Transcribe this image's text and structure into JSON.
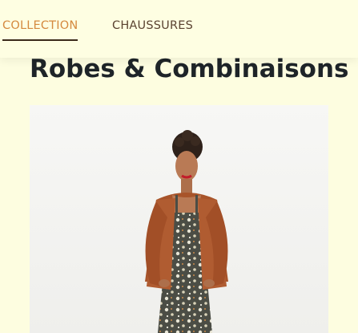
{
  "nav": {
    "tabs": [
      {
        "label": "COLLECTION",
        "active": true
      },
      {
        "label": "CHAUSSURES",
        "active": false
      }
    ],
    "active_color": "#d58a3f",
    "inactive_color": "#5b4331"
  },
  "page": {
    "title": "Robes & Combinaisons"
  },
  "product": {
    "image": "model-in-floral-jumpsuit-and-rust-cardigan"
  },
  "colors": {
    "background": "#fdfde0",
    "title": "#1e2428",
    "cardigan": "#a8542a"
  }
}
